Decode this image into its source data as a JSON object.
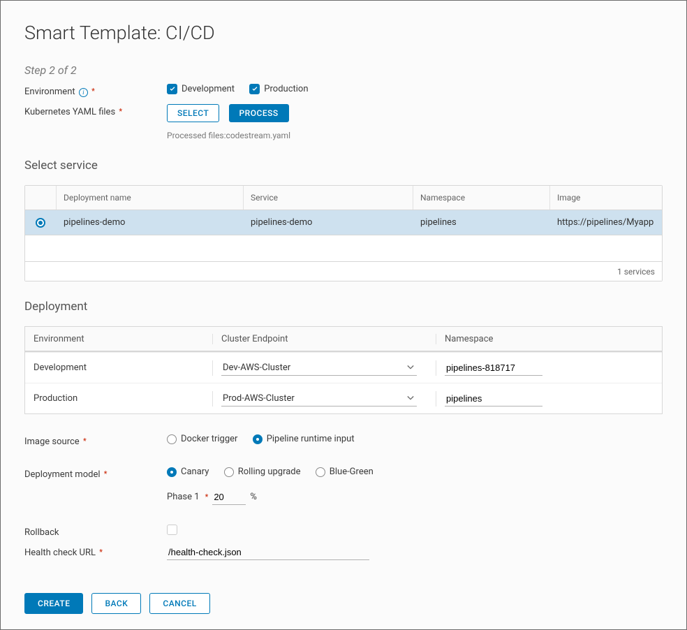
{
  "title": "Smart Template: CI/CD",
  "step": "Step 2 of 2",
  "env": {
    "label": "Environment",
    "development_label": "Development",
    "production_label": "Production"
  },
  "yaml": {
    "label": "Kubernetes YAML files",
    "select_btn": "Select",
    "process_btn": "Process",
    "processed_text": "Processed files:codestream.yaml"
  },
  "service": {
    "heading": "Select service",
    "headers": {
      "deployment": "Deployment name",
      "service": "Service",
      "namespace": "Namespace",
      "image": "Image"
    },
    "row": {
      "deployment": "pipelines-demo",
      "service": "pipelines-demo",
      "namespace": "pipelines",
      "image": "https://pipelines/Myapp"
    },
    "footer": "1 services"
  },
  "deployment": {
    "heading": "Deployment",
    "headers": {
      "environment": "Environment",
      "cluster": "Cluster Endpoint",
      "namespace": "Namespace"
    },
    "rows": [
      {
        "env": "Development",
        "cluster": "Dev-AWS-Cluster",
        "namespace": "pipelines-818717"
      },
      {
        "env": "Production",
        "cluster": "Prod-AWS-Cluster",
        "namespace": "pipelines"
      }
    ]
  },
  "image_source": {
    "label": "Image source",
    "docker": "Docker trigger",
    "runtime": "Pipeline runtime input"
  },
  "deploy_model": {
    "label": "Deployment model",
    "canary": "Canary",
    "rolling": "Rolling upgrade",
    "bluegreen": "Blue-Green",
    "phase_label": "Phase 1",
    "phase_value": "20",
    "pct": "%"
  },
  "rollback": {
    "label": "Rollback"
  },
  "health": {
    "label": "Health check URL",
    "value": "/health-check.json"
  },
  "footer": {
    "create": "Create",
    "back": "Back",
    "cancel": "Cancel"
  }
}
